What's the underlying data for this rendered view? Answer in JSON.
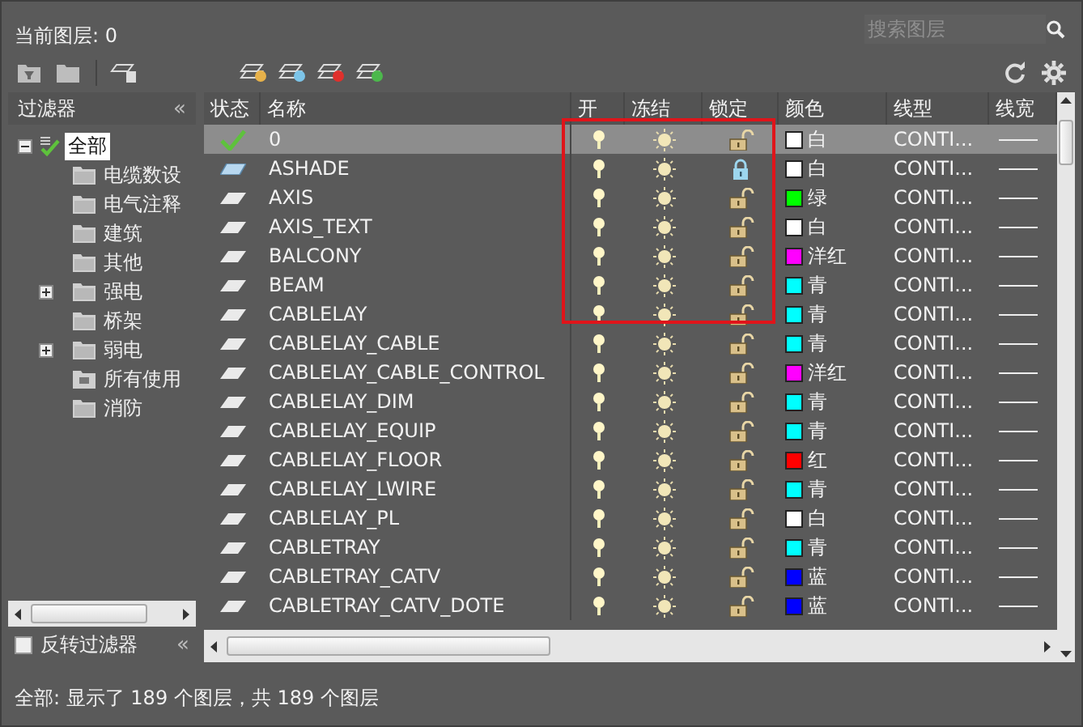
{
  "current_layer": "当前图层: 0",
  "search": {
    "placeholder": "搜索图层"
  },
  "filter_panel": {
    "title": "过滤器",
    "collapse": "«",
    "tree": [
      {
        "label": "全部",
        "selected": true,
        "expanded": true,
        "children": [
          {
            "label": "电缆数设",
            "kind": "group",
            "selected": false,
            "collapsed": false
          },
          {
            "label": "电气注释",
            "kind": "group",
            "selected": false,
            "collapsed": false
          },
          {
            "label": "建筑",
            "kind": "group",
            "selected": false,
            "collapsed": false
          },
          {
            "label": "其他",
            "kind": "group",
            "selected": false,
            "collapsed": false
          },
          {
            "label": "强电",
            "kind": "group",
            "selected": false,
            "collapsed": true
          },
          {
            "label": "桥架",
            "kind": "group",
            "selected": false,
            "collapsed": false
          },
          {
            "label": "弱电",
            "kind": "group",
            "selected": false,
            "collapsed": true
          },
          {
            "label": "所有使用",
            "kind": "filter",
            "selected": false,
            "collapsed": false
          },
          {
            "label": "消防",
            "kind": "group",
            "selected": false,
            "collapsed": false
          }
        ]
      }
    ],
    "invert": {
      "label": "反转过滤器",
      "checked": false
    },
    "collapse_bottom": "«"
  },
  "table": {
    "columns": [
      "状态",
      "名称",
      "开",
      "冻结",
      "锁定",
      "颜色",
      "线型",
      "线宽"
    ],
    "rows": [
      {
        "kind": "current",
        "name": "0",
        "on": true,
        "frozen": false,
        "locked": false,
        "color": "#ffffff",
        "color_name": "白",
        "linetype": "CONTI...",
        "selected": true
      },
      {
        "kind": "active",
        "name": "ASHADE",
        "on": true,
        "frozen": false,
        "locked": true,
        "color": "#ffffff",
        "color_name": "白",
        "linetype": "CONTI...",
        "selected": false
      },
      {
        "kind": "plain",
        "name": "AXIS",
        "on": true,
        "frozen": false,
        "locked": false,
        "color": "#00ff00",
        "color_name": "绿",
        "linetype": "CONTI...",
        "selected": false
      },
      {
        "kind": "plain",
        "name": "AXIS_TEXT",
        "on": true,
        "frozen": false,
        "locked": false,
        "color": "#ffffff",
        "color_name": "白",
        "linetype": "CONTI...",
        "selected": false
      },
      {
        "kind": "plain",
        "name": "BALCONY",
        "on": true,
        "frozen": false,
        "locked": false,
        "color": "#ff00ff",
        "color_name": "洋红",
        "linetype": "CONTI...",
        "selected": false
      },
      {
        "kind": "plain",
        "name": "BEAM",
        "on": true,
        "frozen": false,
        "locked": false,
        "color": "#00ffff",
        "color_name": "青",
        "linetype": "CONTI...",
        "selected": false
      },
      {
        "kind": "plain",
        "name": "CABLELAY",
        "on": true,
        "frozen": false,
        "locked": false,
        "color": "#00ffff",
        "color_name": "青",
        "linetype": "CONTI...",
        "selected": false
      },
      {
        "kind": "plain",
        "name": "CABLELAY_CABLE",
        "on": true,
        "frozen": false,
        "locked": false,
        "color": "#00ffff",
        "color_name": "青",
        "linetype": "CONTI...",
        "selected": false
      },
      {
        "kind": "plain",
        "name": "CABLELAY_CABLE_CONTROL",
        "on": true,
        "frozen": false,
        "locked": false,
        "color": "#ff00ff",
        "color_name": "洋红",
        "linetype": "CONTI...",
        "selected": false
      },
      {
        "kind": "plain",
        "name": "CABLELAY_DIM",
        "on": true,
        "frozen": false,
        "locked": false,
        "color": "#00ffff",
        "color_name": "青",
        "linetype": "CONTI...",
        "selected": false
      },
      {
        "kind": "plain",
        "name": "CABLELAY_EQUIP",
        "on": true,
        "frozen": false,
        "locked": false,
        "color": "#00ffff",
        "color_name": "青",
        "linetype": "CONTI...",
        "selected": false
      },
      {
        "kind": "plain",
        "name": "CABLELAY_FLOOR",
        "on": true,
        "frozen": false,
        "locked": false,
        "color": "#ff0000",
        "color_name": "红",
        "linetype": "CONTI...",
        "selected": false
      },
      {
        "kind": "plain",
        "name": "CABLELAY_LWIRE",
        "on": true,
        "frozen": false,
        "locked": false,
        "color": "#00ffff",
        "color_name": "青",
        "linetype": "CONTI...",
        "selected": false
      },
      {
        "kind": "plain",
        "name": "CABLELAY_PL",
        "on": true,
        "frozen": false,
        "locked": false,
        "color": "#ffffff",
        "color_name": "白",
        "linetype": "CONTI...",
        "selected": false
      },
      {
        "kind": "plain",
        "name": "CABLETRAY",
        "on": true,
        "frozen": false,
        "locked": false,
        "color": "#00ffff",
        "color_name": "青",
        "linetype": "CONTI...",
        "selected": false
      },
      {
        "kind": "plain",
        "name": "CABLETRAY_CATV",
        "on": true,
        "frozen": false,
        "locked": false,
        "color": "#0000ff",
        "color_name": "蓝",
        "linetype": "CONTI...",
        "selected": false
      },
      {
        "kind": "plain",
        "name": "CABLETRAY_CATV_DOTE",
        "on": true,
        "frozen": false,
        "locked": false,
        "color": "#0000ff",
        "color_name": "蓝",
        "linetype": "CONTI...",
        "selected": false
      }
    ]
  },
  "status_bar": "全部: 显示了 189 个图层，共 189 个图层"
}
